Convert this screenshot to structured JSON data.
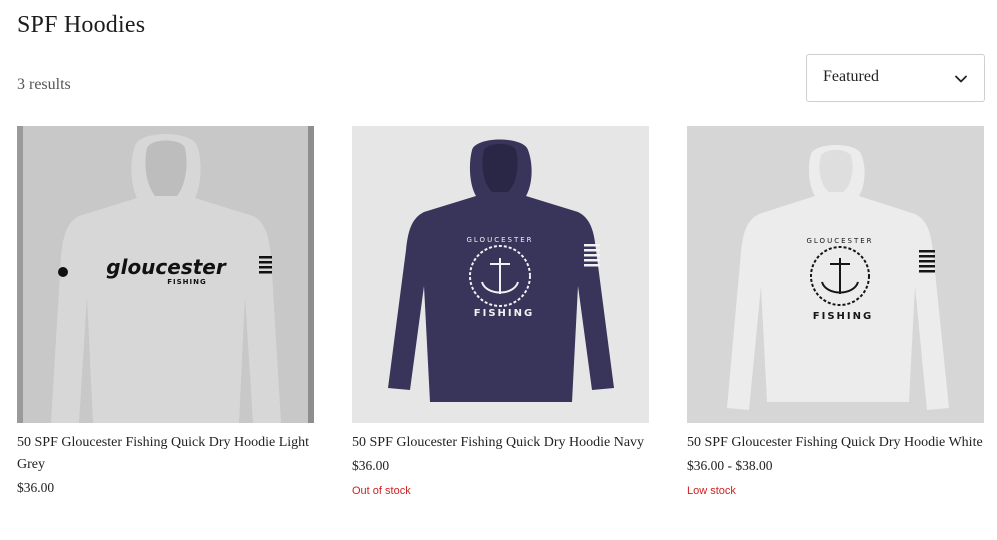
{
  "page": {
    "title": "SPF Hoodies",
    "result_count": "3 results"
  },
  "sort": {
    "selected": "Featured",
    "icon": "chevron-down-icon"
  },
  "products": [
    {
      "name": "50 SPF Gloucester Fishing Quick Dry Hoodie Light Grey",
      "price": "$36.00",
      "stock": "",
      "image": {
        "bg": "#c8c8c8",
        "shirt": "#d7d7d7",
        "print": "#111111",
        "logo_line1": "gloucester",
        "logo_line2": "FISHING"
      }
    },
    {
      "name": "50 SPF Gloucester Fishing Quick Dry Hoodie Navy",
      "price": "$36.00",
      "stock": "Out of stock",
      "image": {
        "bg": "#e6e6e6",
        "shirt": "#38345a",
        "print": "#f2f2f2",
        "logo_line1": "GLOUCESTER",
        "logo_line2": "FISHING"
      }
    },
    {
      "name": "50 SPF Gloucester Fishing Quick Dry Hoodie White",
      "price": "$36.00 - $38.00",
      "stock": "Low stock",
      "image": {
        "bg": "#d6d6d6",
        "shirt": "#ececec",
        "print": "#161616",
        "logo_line1": "GLOUCESTER",
        "logo_line2": "FISHING"
      }
    }
  ],
  "colors": {
    "stock_alert": "#d21f1f",
    "border": "#cfcfcf"
  }
}
